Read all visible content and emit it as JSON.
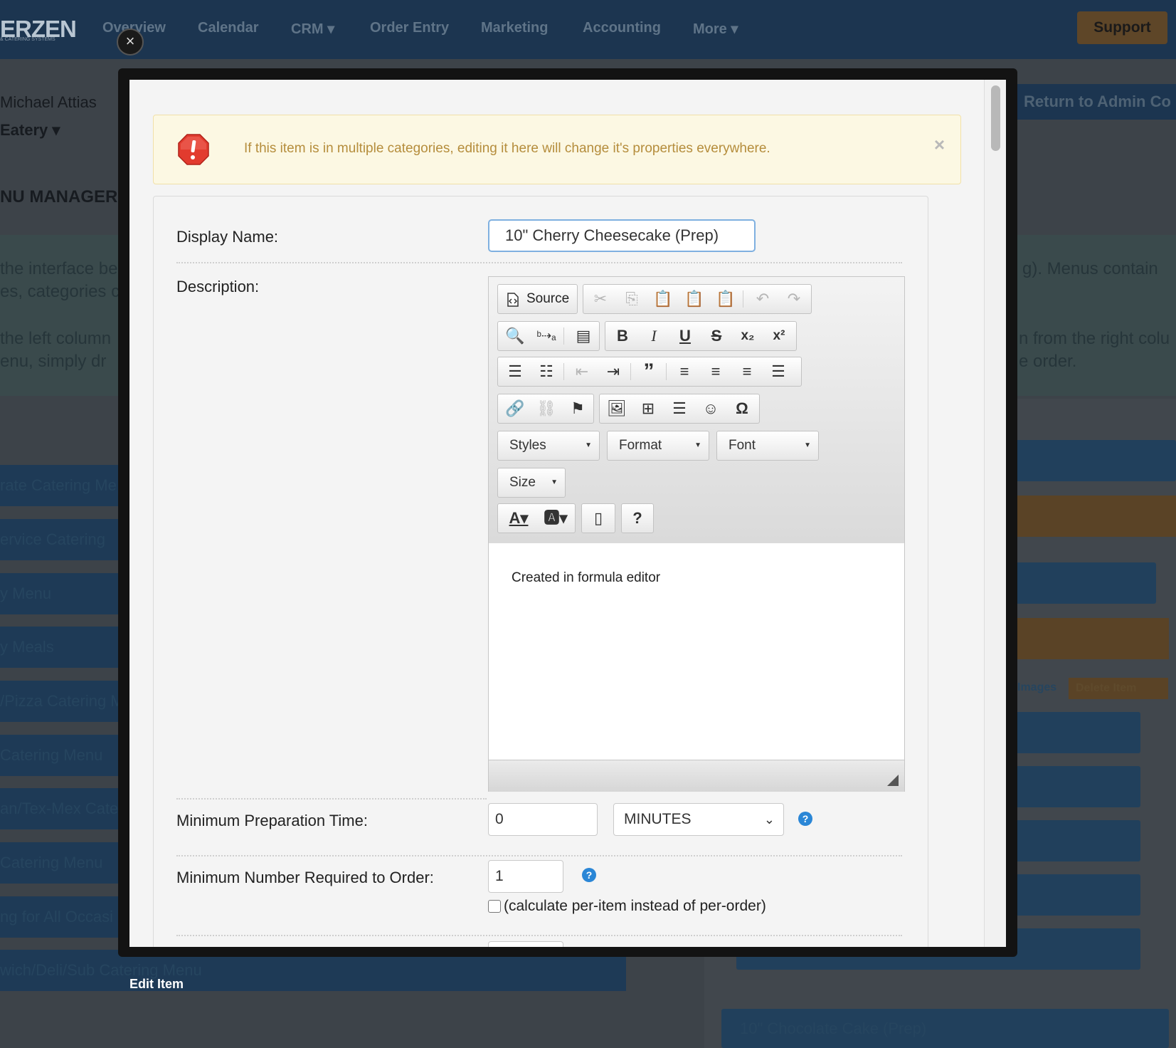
{
  "app": {
    "logo": "ERZEN",
    "logo_sub": "& CATERING SYSTEMS",
    "nav": [
      "Overview",
      "Calendar",
      "CRM ▾",
      "Order Entry",
      "Marketing",
      "Accounting",
      "More ▾"
    ],
    "support_label": "Support",
    "user_name": "Michael Attias",
    "location": "Eatery ▾",
    "page_title": "NU MANAGER",
    "admin_button": "Return to Admin Co",
    "info_lines": [
      "the interface be",
      "es, categories c",
      "the left column",
      "enu, simply dr"
    ],
    "info_right_lines": [
      "g). Menus contain",
      "n from the right colu",
      "e order."
    ],
    "menus": [
      "rate Catering Me",
      "ervice Catering",
      "y Menu",
      "y Meals",
      "/Pizza Catering M",
      "Catering Menu",
      "an/Tex-Mex Cate",
      " Catering Menu",
      "ng for All Occasi",
      "wich/Deli/Sub Catering Menu"
    ],
    "right_buttons": {
      "images": "Images",
      "delete": "Delete Item"
    },
    "right_bottom_item": "10\" Chocolate Cake (Prep)"
  },
  "modal": {
    "caption": "Edit Item",
    "alert_text": "If this item is in multiple categories, editing it here will change it's properties everywhere.",
    "alert_close": "×",
    "outer_close": "×",
    "display_name_label": "Display Name:",
    "display_name_value": "10\" Cherry Cheesecake (Prep)",
    "description_label": "Description:",
    "editor": {
      "source_label": "Source",
      "styles_label": "Styles",
      "format_label": "Format",
      "font_label": "Font",
      "size_label": "Size",
      "content": "Created in formula editor"
    },
    "prep_time_label": "Minimum Preparation Time:",
    "prep_time_value": "0",
    "prep_time_unit": "MINUTES",
    "min_number_label": "Minimum Number Required to Order:",
    "min_number_value": "1",
    "per_item_label": "(calculate per-item instead of per-order)"
  },
  "colors": {
    "alert_bg": "#fcf8e3",
    "alert_text": "#b58d3c",
    "help_icon": "#2a86d6",
    "nav_bg": "#1c3550",
    "support_bg": "#5e4628"
  }
}
